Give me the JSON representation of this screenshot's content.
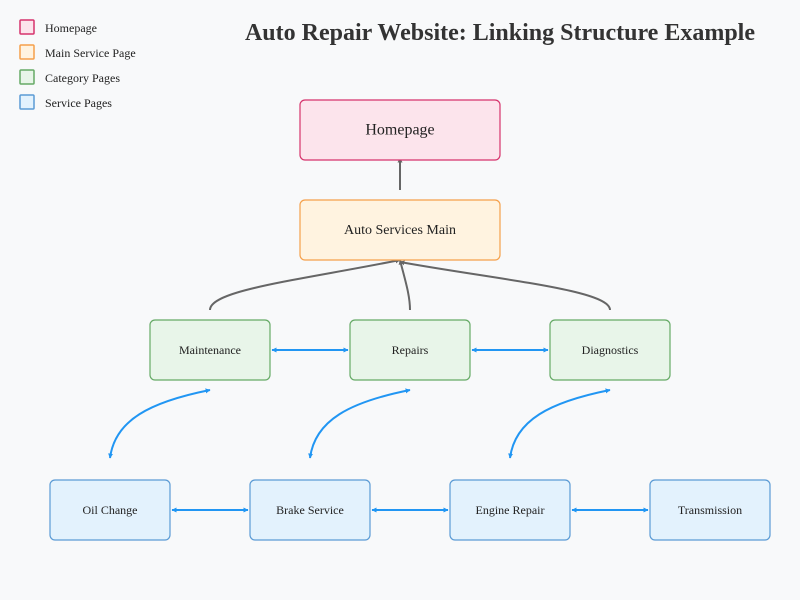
{
  "title": "Auto Repair Website: Linking Structure Example",
  "legend": [
    {
      "label": "Homepage",
      "type": "homepage"
    },
    {
      "label": "Main Service Page",
      "type": "main"
    },
    {
      "label": "Category Pages",
      "type": "category"
    },
    {
      "label": "Service Pages",
      "type": "service"
    }
  ],
  "styles": {
    "homepage": {
      "fill": "#fce4ec",
      "stroke": "#d6336c"
    },
    "main": {
      "fill": "#fff3e0",
      "stroke": "#f5a04a"
    },
    "category": {
      "fill": "#e8f5e9",
      "stroke": "#66aa66"
    },
    "service": {
      "fill": "#e3f2fd",
      "stroke": "#5b9bd5"
    }
  },
  "colors": {
    "hierarchy_link": "#666666",
    "cross_link": "#2196f3",
    "background": "#f8f9fa"
  },
  "nodes": [
    {
      "id": "homepage",
      "label": "Homepage",
      "type": "homepage"
    },
    {
      "id": "main",
      "label": "Auto Services Main",
      "type": "main"
    },
    {
      "id": "maintenance",
      "label": "Maintenance",
      "type": "category"
    },
    {
      "id": "repairs",
      "label": "Repairs",
      "type": "category"
    },
    {
      "id": "diagnostics",
      "label": "Diagnostics",
      "type": "category"
    },
    {
      "id": "oil",
      "label": "Oil Change",
      "type": "service"
    },
    {
      "id": "brake",
      "label": "Brake Service",
      "type": "service"
    },
    {
      "id": "engine",
      "label": "Engine Repair",
      "type": "service"
    },
    {
      "id": "transmission",
      "label": "Transmission",
      "type": "service"
    }
  ],
  "links": [
    {
      "from": "main",
      "to": "homepage",
      "kind": "hierarchy",
      "direction": "forward"
    },
    {
      "from": "maintenance",
      "to": "main",
      "kind": "hierarchy",
      "direction": "forward"
    },
    {
      "from": "repairs",
      "to": "main",
      "kind": "hierarchy",
      "direction": "forward"
    },
    {
      "from": "diagnostics",
      "to": "main",
      "kind": "hierarchy",
      "direction": "forward"
    },
    {
      "from": "maintenance",
      "to": "repairs",
      "kind": "cross",
      "direction": "both"
    },
    {
      "from": "repairs",
      "to": "diagnostics",
      "kind": "cross",
      "direction": "both"
    },
    {
      "from": "oil",
      "to": "maintenance",
      "kind": "cross",
      "direction": "both"
    },
    {
      "from": "brake",
      "to": "repairs",
      "kind": "cross",
      "direction": "both"
    },
    {
      "from": "engine",
      "to": "diagnostics",
      "kind": "cross",
      "direction": "both"
    },
    {
      "from": "oil",
      "to": "brake",
      "kind": "cross",
      "direction": "both"
    },
    {
      "from": "brake",
      "to": "engine",
      "kind": "cross",
      "direction": "both"
    },
    {
      "from": "engine",
      "to": "transmission",
      "kind": "cross",
      "direction": "both"
    }
  ]
}
